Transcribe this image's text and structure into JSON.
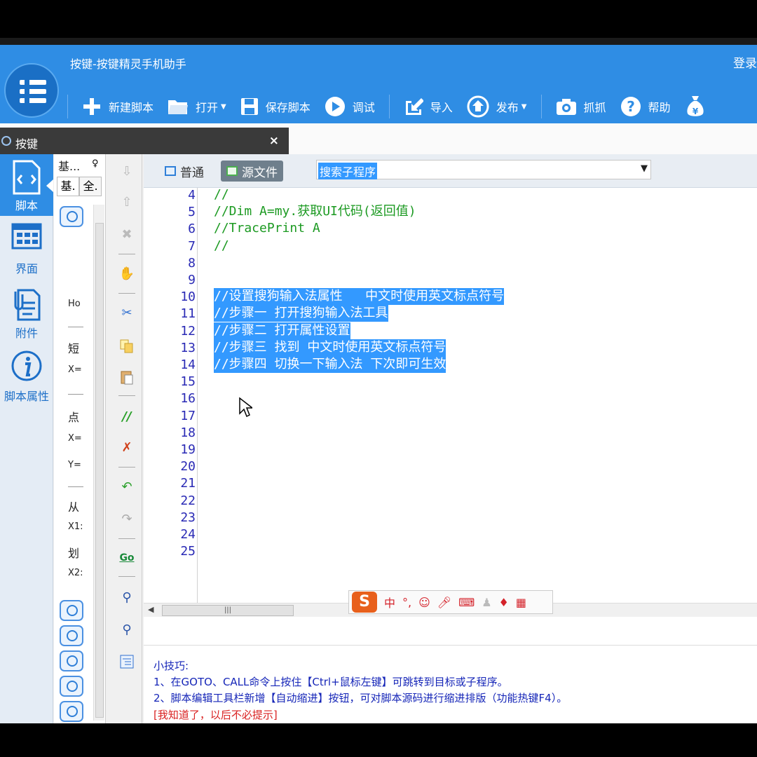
{
  "window": {
    "title": "按键-按键精灵手机助手",
    "login": "登录"
  },
  "toolbar": {
    "new_script": "新建脚本",
    "open": "打开",
    "save_script": "保存脚本",
    "debug": "调试",
    "import": "导入",
    "publish": "发布",
    "capture": "抓抓",
    "help": "帮助"
  },
  "doc_tab": {
    "label": "按键",
    "close": "×"
  },
  "left_nav": {
    "items": [
      {
        "label": "脚本",
        "icon": "script-icon"
      },
      {
        "label": "界面",
        "icon": "grid-icon"
      },
      {
        "label": "附件",
        "icon": "attachment-icon"
      },
      {
        "label": "脚本属性",
        "icon": "info-icon"
      }
    ]
  },
  "cmd_panel": {
    "header": "基...",
    "pin": "♀",
    "tabs": [
      "基.",
      "全."
    ],
    "entries": {
      "ho": "Ho",
      "short": "短",
      "x1": "X=",
      "click": "点",
      "x2": "X=",
      "y": "Y=",
      "from": "从",
      "x1b": "X1:",
      "swipe": "划",
      "x2b": "X2:"
    }
  },
  "editor": {
    "modes": {
      "normal": "普通",
      "source": "源文件"
    },
    "sub_search": "搜索子程序",
    "lines": [
      {
        "n": "4",
        "text": "//",
        "sel": false
      },
      {
        "n": "5",
        "text": "//Dim A=my.获取UI代码(返回值)",
        "sel": false
      },
      {
        "n": "6",
        "text": "//TracePrint A",
        "sel": false
      },
      {
        "n": "7",
        "text": "//",
        "sel": false
      },
      {
        "n": "8",
        "text": "",
        "sel": false
      },
      {
        "n": "9",
        "text": "",
        "sel": false
      },
      {
        "n": "10",
        "text": "//设置搜狗输入法属性   中文时使用英文标点符号",
        "sel": true
      },
      {
        "n": "11",
        "text": "//步骤一 打开搜狗输入法工具",
        "sel": true
      },
      {
        "n": "12",
        "text": "//步骤二 打开属性设置",
        "sel": true
      },
      {
        "n": "13",
        "text": "//步骤三 找到 中文时使用英文标点符号",
        "sel": true
      },
      {
        "n": "14",
        "text": "//步骤四 切换一下输入法 下次即可生效",
        "sel": true
      },
      {
        "n": "15",
        "text": "",
        "sel": false
      },
      {
        "n": "16",
        "text": "",
        "sel": false
      },
      {
        "n": "17",
        "text": "",
        "sel": false
      },
      {
        "n": "18",
        "text": "",
        "sel": false
      },
      {
        "n": "19",
        "text": "",
        "sel": false
      },
      {
        "n": "20",
        "text": "",
        "sel": false
      },
      {
        "n": "21",
        "text": "",
        "sel": false
      },
      {
        "n": "22",
        "text": "",
        "sel": false
      },
      {
        "n": "23",
        "text": "",
        "sel": false
      },
      {
        "n": "24",
        "text": "",
        "sel": false
      },
      {
        "n": "25",
        "text": "",
        "sel": false
      }
    ]
  },
  "ime": {
    "logo": "S",
    "lang": "中",
    "punct": "°,"
  },
  "tips": {
    "title": "小技巧:",
    "line1": "1、在GOTO、CALL命令上按住【Ctrl+鼠标左键】可跳转到目标或子程序。",
    "line2": "2、脚本编辑工具栏新增【自动缩进】按钮，可对脚本源码进行缩进排版（功能热键F4）。",
    "dismiss": "[我知道了，以后不必提示]"
  }
}
